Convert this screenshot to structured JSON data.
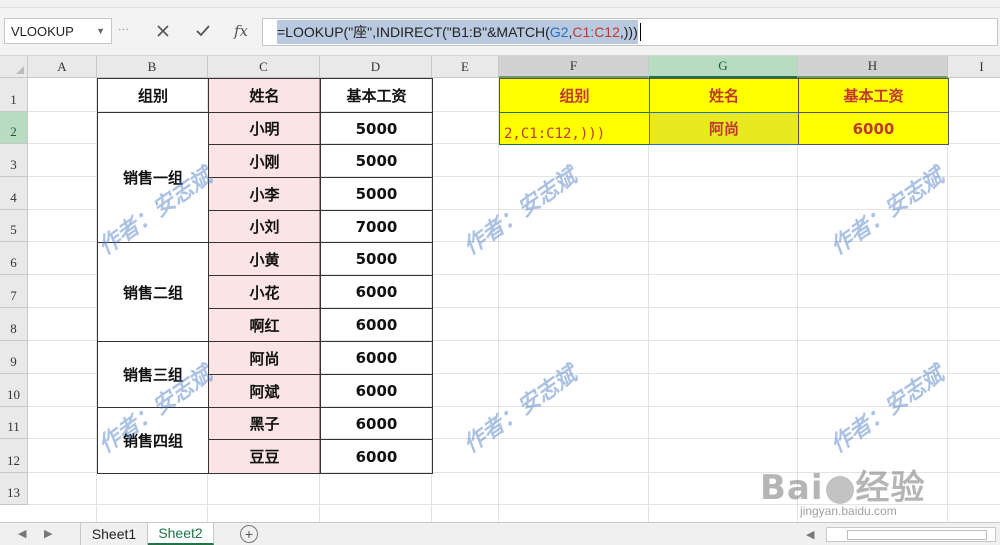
{
  "formula_bar": {
    "name_box": "VLOOKUP",
    "fx_label": "fx",
    "formula_parts": [
      {
        "text": "=LOOKUP(\"座\",INDIRECT(\"B1:B\"&MATCH(",
        "color": "black"
      },
      {
        "text": "G2",
        "color": "blue"
      },
      {
        "text": ",",
        "color": "black"
      },
      {
        "text": "C1:C12",
        "color": "red"
      },
      {
        "text": ",)))",
        "color": "black"
      }
    ]
  },
  "columns": [
    "A",
    "B",
    "C",
    "D",
    "E",
    "F",
    "G",
    "H",
    "I"
  ],
  "rows": [
    "1",
    "2",
    "3",
    "4",
    "5",
    "6",
    "7",
    "8",
    "9",
    "10",
    "11",
    "12",
    "13"
  ],
  "table": {
    "headers": [
      "组别",
      "姓名",
      "基本工资"
    ],
    "groups": [
      "销售一组",
      "销售二组",
      "销售三组",
      "销售四组"
    ],
    "names": [
      "小明",
      "小刚",
      "小李",
      "小刘",
      "小黄",
      "小花",
      "啊红",
      "阿尚",
      "阿斌",
      "黑子",
      "豆豆"
    ],
    "salaries": [
      "5000",
      "5000",
      "5000",
      "7000",
      "5000",
      "6000",
      "6000",
      "6000",
      "6000",
      "6000",
      "6000"
    ]
  },
  "lookup": {
    "headers": [
      "组别",
      "姓名",
      "基本工资"
    ],
    "f2_editing": "2,C1:C12,)))",
    "g2": "阿尚",
    "h2": "6000"
  },
  "watermark_text": "作者：安志斌",
  "sheet_tabs": [
    "Sheet1",
    "Sheet2"
  ],
  "active_sheet": "Sheet2",
  "baidu": {
    "logo": "Baidu经验",
    "url": "jingyan.baidu.com"
  },
  "colors": {
    "yellow_fill": "#ffff00",
    "pink_fill": "#fbe4e6",
    "header_red": "#c0392b",
    "accent_green": "#217346"
  }
}
